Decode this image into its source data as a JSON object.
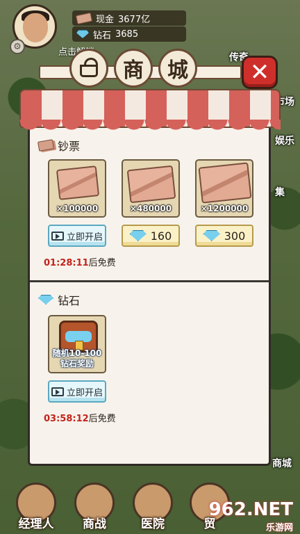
{
  "hud": {
    "cash_label": "现金",
    "cash_value": "3677亿",
    "gem_label": "钻石",
    "gem_value": "3685",
    "hint": "点击解锁"
  },
  "world_labels": {
    "right_top": "传奇",
    "right_market": "市场",
    "right_fun": "娱乐",
    "right_collect": "集",
    "right_bottom": "商城"
  },
  "shop": {
    "title_chars": [
      "商",
      "城"
    ],
    "close_label": "✕",
    "sections": [
      {
        "name": "钞票",
        "items": [
          {
            "qty": "×100000",
            "action": "立即开启",
            "action_type": "ad"
          },
          {
            "qty": "×480000",
            "action": "160",
            "action_type": "gem"
          },
          {
            "qty": "×1200000",
            "action": "300",
            "action_type": "gem"
          }
        ],
        "timer": "01:28:11",
        "timer_suffix": "后免费"
      },
      {
        "name": "钻石",
        "items": [
          {
            "label_line1": "随机10-100",
            "label_line2": "钻石奖励",
            "action": "立即开启",
            "action_type": "ad"
          }
        ],
        "timer": "03:58:12",
        "timer_suffix": "后免费"
      }
    ]
  },
  "bottom_nav": [
    {
      "label": "经理人"
    },
    {
      "label": "商战"
    },
    {
      "label": "医院"
    },
    {
      "label": "贸"
    }
  ],
  "watermark": {
    "main": "962.NET",
    "sub": "乐游网"
  },
  "colors": {
    "close_red": "#cf2f2a",
    "awning_red": "#d4615a",
    "timer_red": "#c3231c",
    "panel_bg": "#f7f3ec",
    "gem_blue": "#78cfee"
  },
  "icons": {
    "settings": "gear-icon",
    "shop": "shopping-basket-icon",
    "close": "close-icon",
    "cash": "banknote-icon",
    "gem": "diamond-icon",
    "ad": "video-icon",
    "chest": "treasure-chest-icon"
  }
}
